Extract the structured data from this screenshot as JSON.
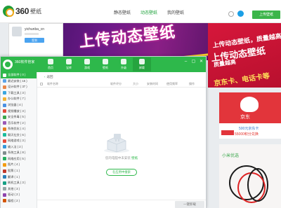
{
  "site": {
    "logo_text": "360",
    "logo_sub": "壁纸",
    "nav": [
      "静态壁纸",
      "动态壁纸",
      "我的壁纸"
    ],
    "upload_label": "上传壁纸",
    "banner_text": "上传动态壁纸",
    "profile": {
      "name": "yichunba_cn",
      "button": "签到"
    },
    "ad": {
      "line1": "上传动态壁纸",
      "line2": "质量越高",
      "line3": "京东卡、电话卡等",
      "line4": "上传动态壁纸，质量越高"
    },
    "jd": {
      "brand": "京东",
      "line1": "500元京东卡",
      "line2": "55000积分兑换"
    },
    "xiaomi": {
      "label": "小米优选"
    }
  },
  "app": {
    "title": "360软件管家",
    "tabs": [
      {
        "label": "首页",
        "icon": "home-icon"
      },
      {
        "label": "宝库",
        "icon": "treasure-icon"
      },
      {
        "label": "游戏",
        "icon": "game-icon"
      },
      {
        "label": "壁纸",
        "icon": "wallpaper-icon"
      },
      {
        "label": "升级",
        "icon": "upgrade-icon"
      },
      {
        "label": "卸载",
        "icon": "uninstall-icon"
      }
    ],
    "window_controls": [
      "min-icon",
      "max-icon",
      "close-icon"
    ],
    "sidebar": [
      {
        "label": "全部软件 ( 0 )",
        "color": "#ffffff"
      },
      {
        "label": "最近安装 ( 15 )",
        "color": "#5aa3e8"
      },
      {
        "label": "设计软件 ( 37 )",
        "color": "#e8884a"
      },
      {
        "label": "下载工具 ( 3 )",
        "color": "#3aa6e0"
      },
      {
        "label": "办公软件 ( 7 )",
        "color": "#f2b233"
      },
      {
        "label": "浏览器 ( 4 )",
        "color": "#4a90e2"
      },
      {
        "label": "视频播放 ( 3 )",
        "color": "#e14b3a"
      },
      {
        "label": "安全杀毒 ( 5 )",
        "color": "#3aa64b"
      },
      {
        "label": "音乐软件 ( 2 )",
        "color": "#9b59b6"
      },
      {
        "label": "系统优化 ( 4 )",
        "color": "#e67e22"
      },
      {
        "label": "聊天社交 ( 6 )",
        "color": "#1abc9c"
      },
      {
        "label": "网络游戏 ( 3 )",
        "color": "#e74c3c"
      },
      {
        "label": "输入法 ( 2 )",
        "color": "#3498db"
      },
      {
        "label": "系统工具 ( 8 )",
        "color": "#7f8c8d"
      },
      {
        "label": "网络应用 ( 5 )",
        "color": "#27ae60"
      },
      {
        "label": "图片 ( 4 )",
        "color": "#f39c12"
      },
      {
        "label": "股票 ( 1 )",
        "color": "#c0392b"
      },
      {
        "label": "翻译 ( 1 )",
        "color": "#2980b9"
      },
      {
        "label": "刷机工具 ( 3 )",
        "color": "#16a085"
      },
      {
        "label": "其他 ( 3 )",
        "color": "#95a5a6"
      },
      {
        "label": "驱动 ( 2 )",
        "color": "#8e44ad"
      },
      {
        "label": "编程 ( 2 )",
        "color": "#d35400"
      }
    ],
    "breadcrumb": {
      "back": "‹",
      "label": "返回"
    },
    "columns": [
      "软件名称",
      "软件评分",
      "大小",
      "安装时间",
      "使用频率",
      "操作"
    ],
    "empty": {
      "message": "您的电脑中未安装",
      "link": "壁纸",
      "button": "在应用中搜索"
    },
    "footer": {
      "uninstall": "一键卸载"
    }
  }
}
